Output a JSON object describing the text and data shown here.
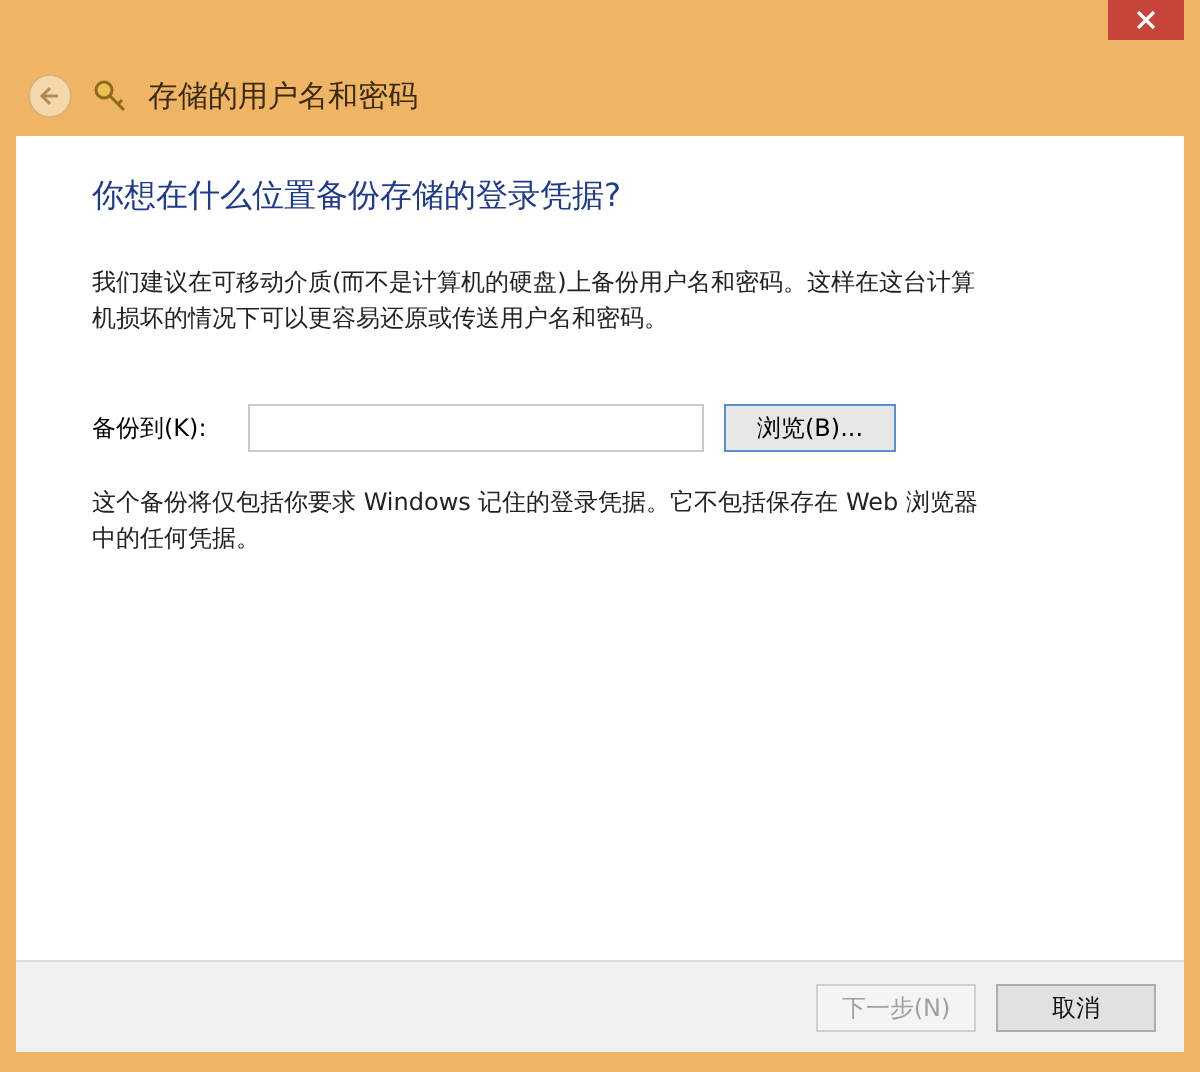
{
  "window": {
    "title": "存储的用户名和密码"
  },
  "heading": "你想在什么位置备份存储的登录凭据?",
  "intro": "我们建议在可移动介质(而不是计算机的硬盘)上备份用户名和密码。这样在这台计算机损坏的情况下可以更容易还原或传送用户名和密码。",
  "backup_field": {
    "label": "备份到(K):"
  },
  "browse_button": "浏览(B)...",
  "note": "这个备份将仅包括你要求 Windows 记住的登录凭据。它不包括保存在 Web 浏览器中的任何凭据。",
  "footer_buttons": [
    {
      "label": "下一步(N)",
      "disabled": true
    },
    {
      "label": "取消",
      "disabled": false
    }
  ]
}
